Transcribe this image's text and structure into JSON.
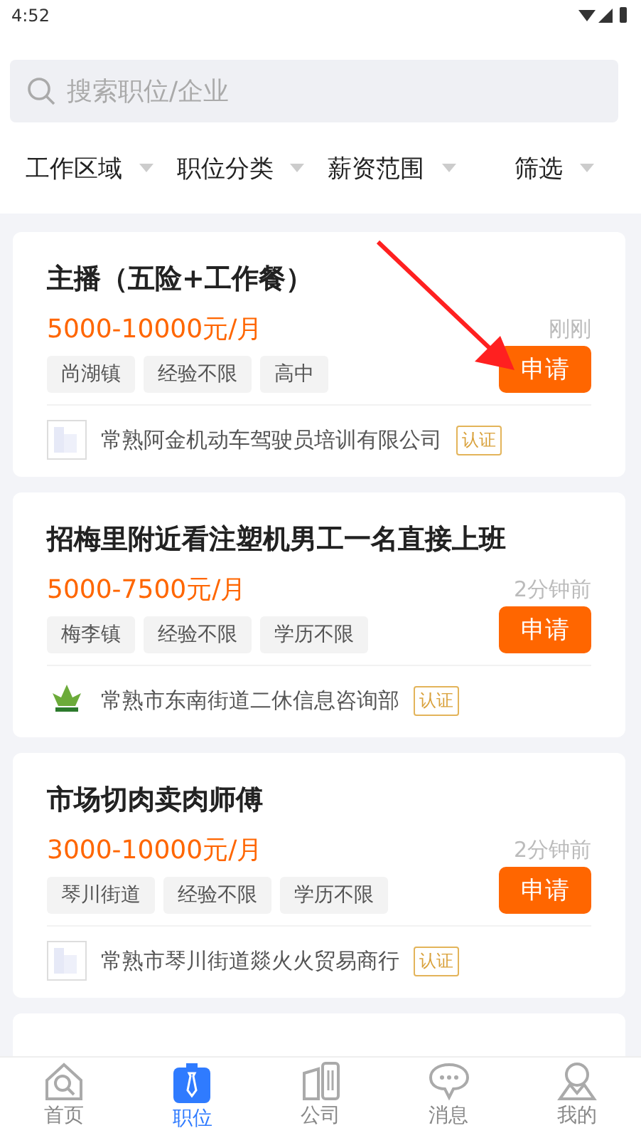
{
  "status_bar": {
    "time": "4:52"
  },
  "search": {
    "placeholder": "搜索职位/企业"
  },
  "filters": [
    {
      "label": "工作区域"
    },
    {
      "label": "职位分类"
    },
    {
      "label": "薪资范围"
    },
    {
      "label": "筛选"
    }
  ],
  "jobs": [
    {
      "title": "主播（五险+工作餐）",
      "salary": "5000-10000元/月",
      "time": "刚刚",
      "tags": [
        "尚湖镇",
        "经验不限",
        "高中"
      ],
      "apply": "申请",
      "company": {
        "kind": "building",
        "name": "常熟阿金机动车驾驶员培训有限公司",
        "badge": "认证"
      }
    },
    {
      "title": "招梅里附近看注塑机男工一名直接上班",
      "salary": "5000-7500元/月",
      "time": "2分钟前",
      "tags": [
        "梅李镇",
        "经验不限",
        "学历不限"
      ],
      "apply": "申请",
      "company": {
        "kind": "plant",
        "name": "常熟市东南街道二休信息咨询部",
        "badge": "认证"
      }
    },
    {
      "title": "市场切肉卖肉师傅",
      "salary": "3000-10000元/月",
      "time": "2分钟前",
      "tags": [
        "琴川街道",
        "经验不限",
        "学历不限"
      ],
      "apply": "申请",
      "company": {
        "kind": "building",
        "name": "常熟市琴川街道燚火火贸易商行",
        "badge": "认证"
      }
    }
  ],
  "nav": [
    {
      "label": "首页",
      "kind": "home",
      "selected": false
    },
    {
      "label": "职位",
      "kind": "job",
      "selected": true
    },
    {
      "label": "公司",
      "kind": "company",
      "selected": false
    },
    {
      "label": "消息",
      "kind": "message",
      "selected": false
    },
    {
      "label": "我的",
      "kind": "me",
      "selected": false
    }
  ]
}
